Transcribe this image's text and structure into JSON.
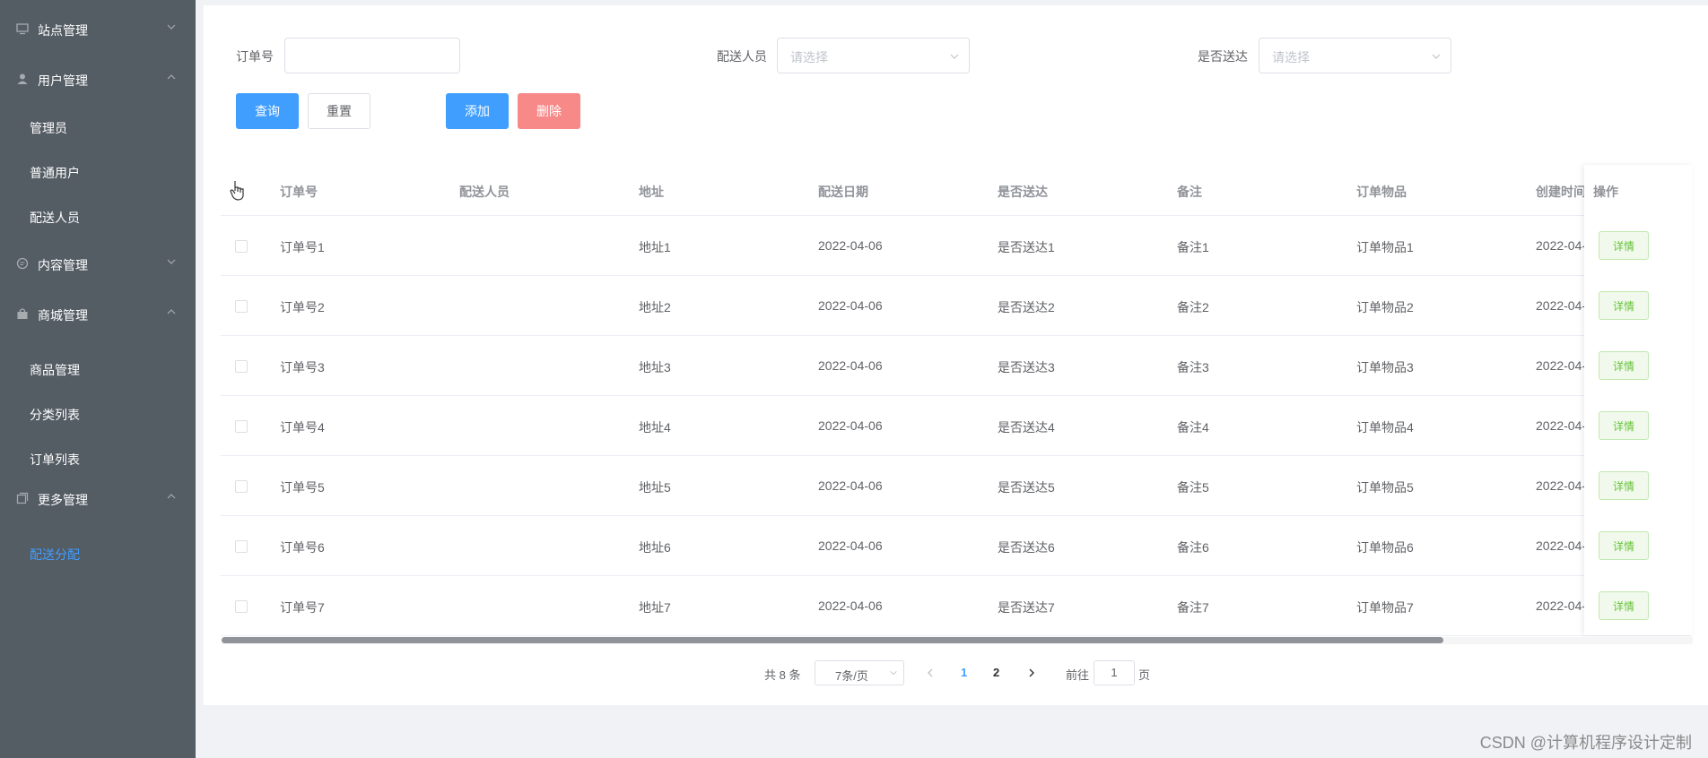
{
  "sidebar": {
    "groups": [
      {
        "label": "站点管理",
        "icon": "monitor-icon"
      },
      {
        "label": "用户管理",
        "icon": "user-icon"
      },
      {
        "label": "内容管理",
        "icon": "chat-icon"
      },
      {
        "label": "商城管理",
        "icon": "bag-icon"
      },
      {
        "label": "更多管理",
        "icon": "copy-icon"
      }
    ],
    "items": {
      "admin": "管理员",
      "normal_user": "普通用户",
      "courier": "配送人员",
      "goods": "商品管理",
      "category": "分类列表",
      "orders": "订单列表",
      "dispatch": "配送分配"
    }
  },
  "search": {
    "order_label": "订单号",
    "order_value": "",
    "courier_label": "配送人员",
    "courier_placeholder": "请选择",
    "delivered_label": "是否送达",
    "delivered_placeholder": "请选择"
  },
  "buttons": {
    "query": "查询",
    "reset": "重置",
    "add": "添加",
    "delete": "删除"
  },
  "table": {
    "headers": [
      "订单号",
      "配送人员",
      "地址",
      "配送日期",
      "是否送达",
      "备注",
      "订单物品",
      "创建时间",
      "操作"
    ],
    "rows": [
      {
        "order": "订单号1",
        "courier": "",
        "address": "地址1",
        "date": "2022-04-06",
        "delivered": "是否送达1",
        "remark": "备注1",
        "goods": "订单物品1",
        "created": "2022-04-"
      },
      {
        "order": "订单号2",
        "courier": "",
        "address": "地址2",
        "date": "2022-04-06",
        "delivered": "是否送达2",
        "remark": "备注2",
        "goods": "订单物品2",
        "created": "2022-04-"
      },
      {
        "order": "订单号3",
        "courier": "",
        "address": "地址3",
        "date": "2022-04-06",
        "delivered": "是否送达3",
        "remark": "备注3",
        "goods": "订单物品3",
        "created": "2022-04-"
      },
      {
        "order": "订单号4",
        "courier": "",
        "address": "地址4",
        "date": "2022-04-06",
        "delivered": "是否送达4",
        "remark": "备注4",
        "goods": "订单物品4",
        "created": "2022-04-"
      },
      {
        "order": "订单号5",
        "courier": "",
        "address": "地址5",
        "date": "2022-04-06",
        "delivered": "是否送达5",
        "remark": "备注5",
        "goods": "订单物品5",
        "created": "2022-04-"
      },
      {
        "order": "订单号6",
        "courier": "",
        "address": "地址6",
        "date": "2022-04-06",
        "delivered": "是否送达6",
        "remark": "备注6",
        "goods": "订单物品6",
        "created": "2022-04-"
      },
      {
        "order": "订单号7",
        "courier": "",
        "address": "地址7",
        "date": "2022-04-06",
        "delivered": "是否送达7",
        "remark": "备注7",
        "goods": "订单物品7",
        "created": "2022-04-"
      }
    ],
    "detail_label": "详情"
  },
  "pagination": {
    "total": "共 8 条",
    "page_size": "7条/页",
    "pages": [
      "1",
      "2"
    ],
    "current_page": "1",
    "goto_label": "前往",
    "goto_value": "1",
    "page_unit": "页"
  },
  "watermark": "CSDN @计算机程序设计定制",
  "colors": {
    "sidebar_bg": "#545c64",
    "primary": "#409eff",
    "danger": "#f78989",
    "success": "#67c23a"
  }
}
